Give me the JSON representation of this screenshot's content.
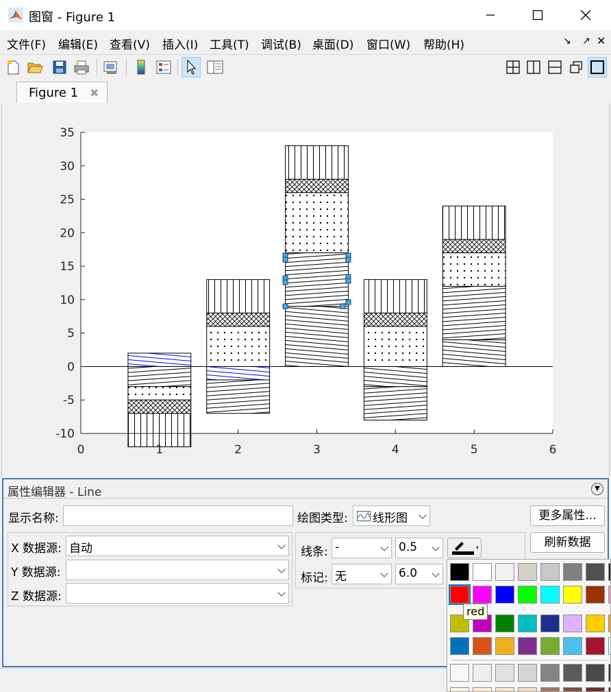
{
  "window": {
    "title": "图窗 - Figure 1",
    "icon": "matlab-logo-icon"
  },
  "menubar": {
    "items": [
      "文件(F)",
      "编辑(E)",
      "查看(V)",
      "插入(I)",
      "工具(T)",
      "调试(B)",
      "桌面(D)",
      "窗口(W)",
      "帮助(H)"
    ]
  },
  "toolbar": {
    "buttons": [
      "new-figure-icon",
      "open-icon",
      "save-icon",
      "print-icon",
      "link-plot-icon",
      "insert-colorbar-icon",
      "insert-legend-icon",
      "edit-plot-icon",
      "property-inspector-icon"
    ],
    "layout_buttons": [
      "tile-icon",
      "left-right-icon",
      "top-bottom-icon",
      "float-icon",
      "maximize-icon"
    ]
  },
  "tabs": [
    {
      "label": "Figure 1"
    }
  ],
  "chart_data": {
    "type": "bar",
    "stacked": true,
    "xlim": [
      0,
      6
    ],
    "ylim": [
      -10,
      35
    ],
    "xticks": [
      "0",
      "1",
      "2",
      "3",
      "4",
      "5",
      "6"
    ],
    "yticks": [
      "-10",
      "-5",
      "0",
      "5",
      "10",
      "15",
      "20",
      "25",
      "30",
      "35"
    ],
    "categories": [
      1,
      2,
      3,
      4,
      5
    ],
    "series": [
      {
        "values": [
          2,
          -2,
          9,
          -3,
          4
        ],
        "hatch": "diagonal-steep"
      },
      {
        "values": [
          -3,
          -5,
          8,
          -5,
          8
        ],
        "hatch": "diagonal-shallow"
      },
      {
        "values": [
          -2,
          6,
          9,
          6,
          5
        ],
        "hatch": "dots"
      },
      {
        "values": [
          -2,
          2,
          2,
          2,
          2
        ],
        "hatch": "crosshatch"
      },
      {
        "values": [
          -5,
          5,
          5,
          5,
          5
        ],
        "hatch": "vertical"
      }
    ],
    "highlighted_series_color": "#0000ff",
    "grid": false
  },
  "property_editor": {
    "title": "属性编辑器 - Line",
    "display_name_label": "显示名称:",
    "display_name_value": "",
    "plot_type_label": "绘图类型:",
    "plot_type_value": "线形图",
    "more_props_button": "更多属性...",
    "refresh_button": "刷新数据",
    "x_source_label": "X 数据源:",
    "x_source_value": "自动",
    "y_source_label": "Y 数据源:",
    "y_source_value": "",
    "z_source_label": "Z 数据源:",
    "z_source_value": "",
    "line_label": "线条:",
    "line_style": "-",
    "line_width": "0.5",
    "marker_label": "标记:",
    "marker_value": "无",
    "marker_size": "6.0"
  },
  "color_palette": {
    "tooltip": "red",
    "rows": [
      [
        "#000000",
        "#ffffff",
        "#f0f0f0",
        "#d4d0c8",
        "#c8c8c8",
        "#808080",
        "#505050",
        "#202020"
      ],
      [
        "#ff0000",
        "#ff00ff",
        "#0000ff",
        "#00ff00",
        "#00ffff",
        "#ffff00",
        "#993300",
        "#ff99cc"
      ],
      [
        "#bfbf00",
        "#bf00bf",
        "#008000",
        "#00bfbf",
        "#1f2f8f",
        "#ddb3ff",
        "#ffcc00",
        "#ff9900"
      ],
      [
        "#0072bd",
        "#d95319",
        "#edb120",
        "#7e2f8e",
        "#77ac30",
        "#4dbeee",
        "#a2142f",
        "#e6ffff"
      ],
      [
        "#f7f7f7",
        "#eeeeee",
        "#e1e1e1",
        "#d4d4d4",
        "#848484",
        "#5a5a5a",
        "#4a4a4a",
        "#3a3a3a"
      ],
      [
        "#fbf1e3",
        "#fbebd3",
        "#f8e4c8",
        "#eedcc4",
        "#a07860",
        "#7a5040",
        "#6a3030",
        "#502020"
      ]
    ]
  }
}
